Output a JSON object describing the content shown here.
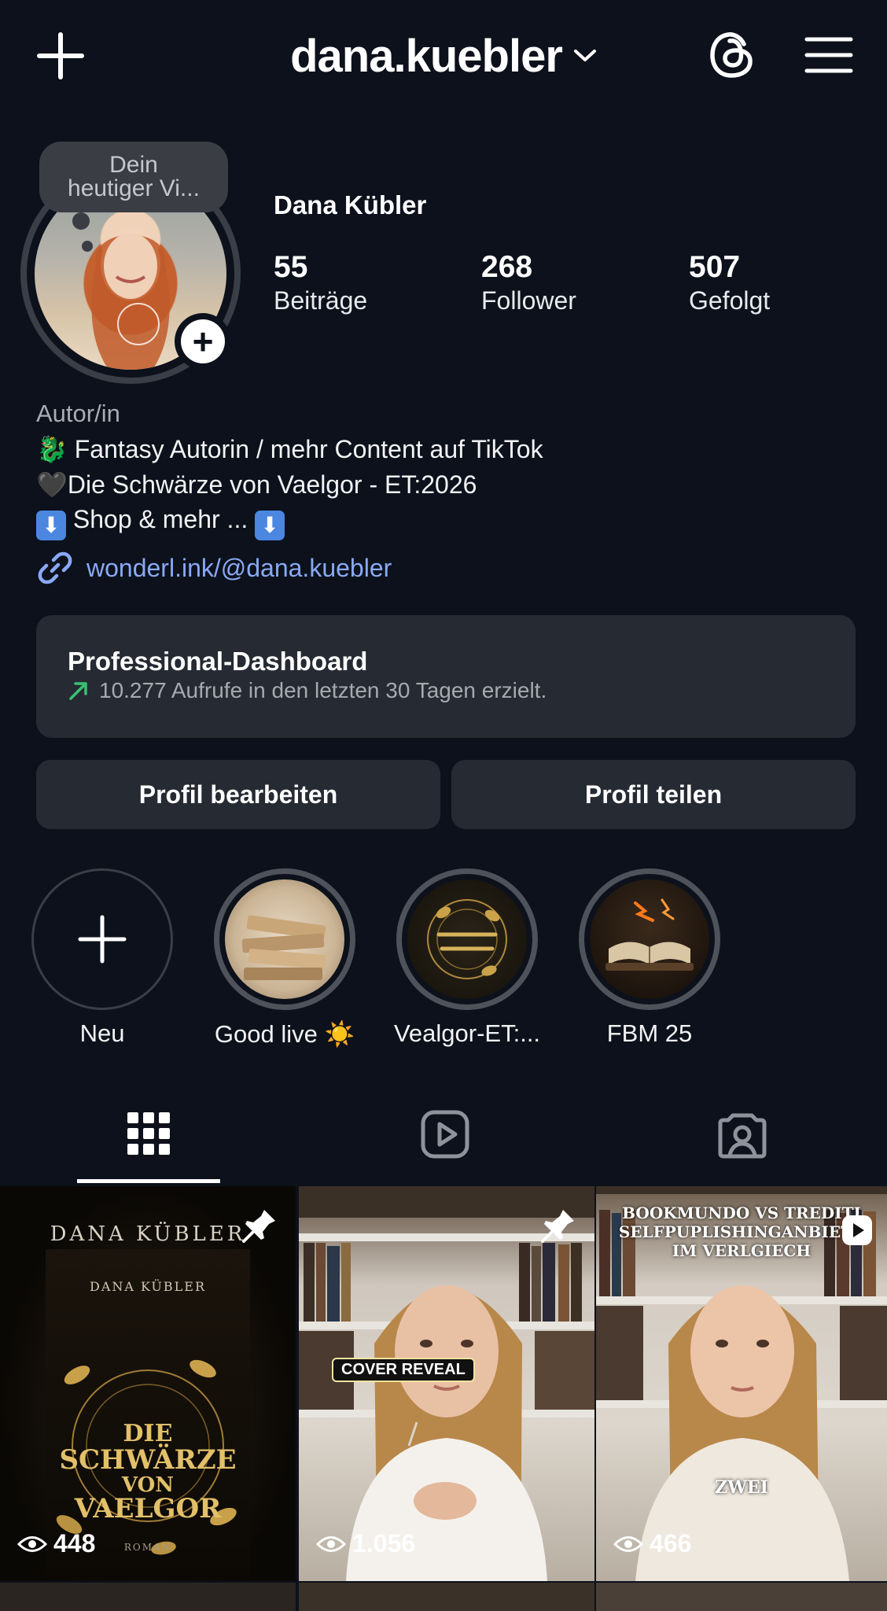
{
  "header": {
    "username": "dana.kuebler",
    "icons": [
      "plus-icon",
      "chevron-down-icon",
      "threads-icon",
      "menu-icon"
    ]
  },
  "profile": {
    "note": [
      "Dein",
      "heutiger Vi..."
    ],
    "name": "Dana Kübler",
    "stats": [
      {
        "value": "55",
        "label": "Beiträge"
      },
      {
        "value": "268",
        "label": "Follower"
      },
      {
        "value": "507",
        "label": "Gefolgt"
      }
    ],
    "category": "Autor/in",
    "bio": [
      "🐉 Fantasy Autorin / mehr Content auf TikTok",
      "🖤Die Schwärze von Vaelgor - ET:2026",
      "Shop & mehr ..."
    ],
    "link": "wonderl.ink/@dana.kuebler"
  },
  "dashboard": {
    "title": "Professional-Dashboard",
    "subtitle": "10.277 Aufrufe in den letzten 30 Tagen erzielt."
  },
  "buttons": {
    "edit": "Profil bearbeiten",
    "share": "Profil teilen"
  },
  "highlights": [
    {
      "label": "Neu"
    },
    {
      "label": "Good live ☀️"
    },
    {
      "label": "Vealgor-ET:..."
    },
    {
      "label": "FBM 25"
    }
  ],
  "tabs": [
    "grid-icon",
    "reels-icon",
    "tagged-icon"
  ],
  "posts": [
    {
      "views": "448",
      "pinned": true,
      "author": "DANA KÜBLER",
      "author_small": "DANA KÜBLER",
      "book_lines": [
        "DIE",
        "SCHWÄRZE",
        "VON",
        "VAELGOR"
      ],
      "publisher": "ROMAN"
    },
    {
      "views": "1.056",
      "pinned": true,
      "overlay": "COVER REVEAL"
    },
    {
      "views": "466",
      "pinned": false,
      "caption": [
        "BOOKMUNDO VS TREDITI",
        "SELFPUPLISHINGANBIETE",
        "IM VERLGIECH"
      ],
      "overlay": "ZWEI"
    }
  ],
  "colors": {
    "background": "#0c111b",
    "card": "#262b33",
    "link": "#8aa9f5",
    "trend": "#38c172"
  }
}
